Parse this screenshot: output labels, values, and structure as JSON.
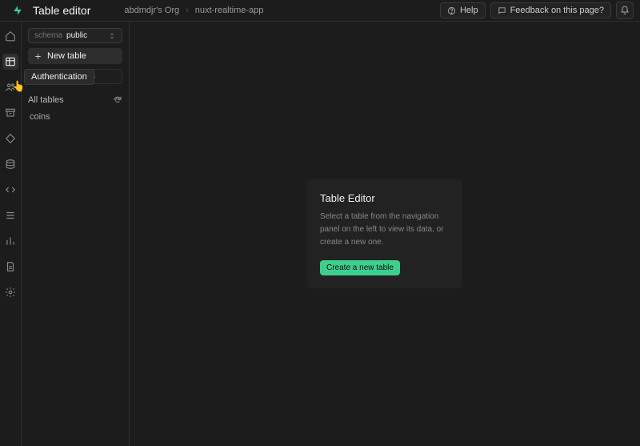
{
  "brand_color": "#3ecf8e",
  "header": {
    "title": "Table editor",
    "breadcrumbs": [
      "abdmdjr's Org",
      "nuxt-realtime-app"
    ],
    "help_label": "Help",
    "feedback_label": "Feedback on this page?"
  },
  "sidebar": {
    "tooltip_label": "Authentication"
  },
  "panel": {
    "schema_label": "schema",
    "schema_value": "public",
    "new_table_label": "New table",
    "search_placeholder": "Search tables",
    "section_label": "All tables",
    "tables": [
      "coins"
    ]
  },
  "empty_state": {
    "title": "Table Editor",
    "description": "Select a table from the navigation panel on the left to view its data, or create a new one.",
    "cta_label": "Create a new table"
  }
}
